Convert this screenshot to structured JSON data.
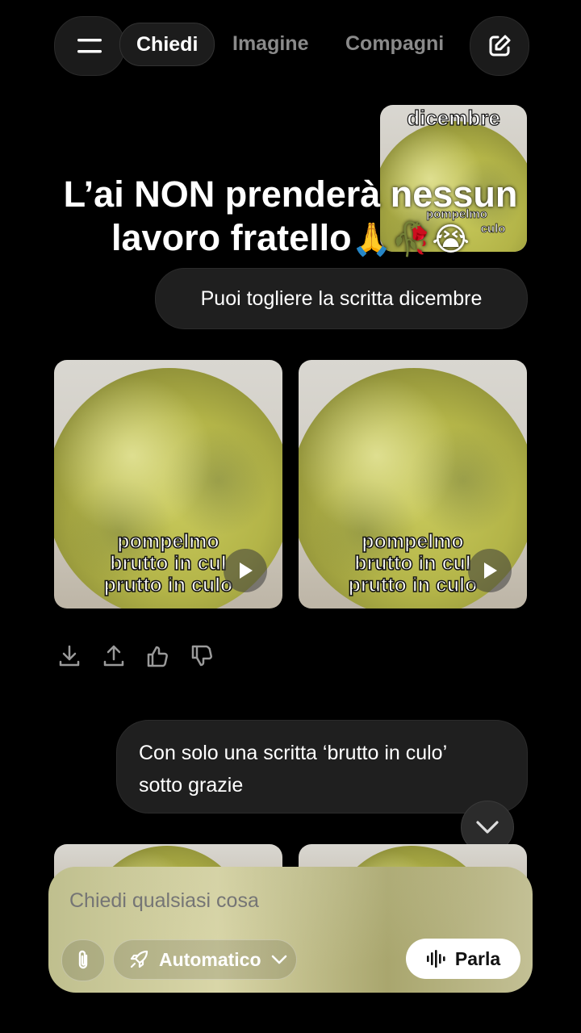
{
  "topbar": {
    "tabs": [
      {
        "label": "Chiedi",
        "active": true
      },
      {
        "label": "Imagine",
        "active": false
      },
      {
        "label": "Compagni",
        "active": false
      }
    ]
  },
  "thumbnail": {
    "caption_top": "dicembre",
    "caption_bottom_1": "pompelmo",
    "caption_bottom_2": "culo"
  },
  "overlay_text": {
    "line1": "L’ai NON prenderà nessun",
    "line2": "lavoro fratello",
    "emoji": "🙏🥀😭"
  },
  "messages": [
    {
      "role": "user",
      "text": "Puoi togliere la scritta dicembre"
    },
    {
      "role": "user",
      "text_line1": "Con solo una scritta ‘brutto in culo’",
      "text_line2": "sotto grazie"
    }
  ],
  "results": [
    {
      "lines": [
        "pompelmo",
        "brutto in cul",
        "prutto in culo"
      ]
    },
    {
      "lines": [
        "pompelmo",
        "brutto in cul",
        "prutto in culo"
      ]
    }
  ],
  "composer": {
    "placeholder": "Chiedi qualsiasi cosa",
    "mode_label": "Automatico",
    "speak_label": "Parla"
  },
  "colors": {
    "background": "#000000",
    "bubble": "#1f1f1f",
    "fruit": "#b3b448"
  }
}
